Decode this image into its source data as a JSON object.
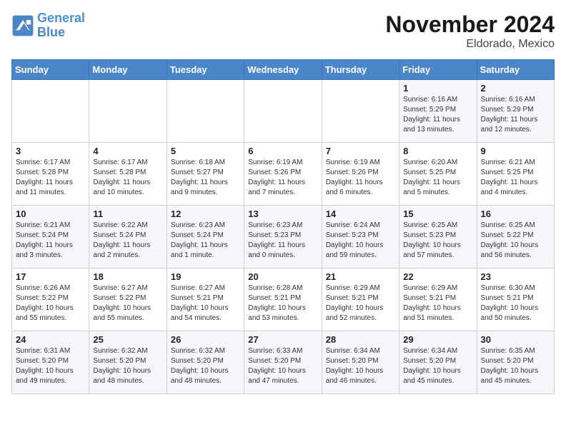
{
  "logo": {
    "line1": "General",
    "line2": "Blue"
  },
  "title": "November 2024",
  "location": "Eldorado, Mexico",
  "weekdays": [
    "Sunday",
    "Monday",
    "Tuesday",
    "Wednesday",
    "Thursday",
    "Friday",
    "Saturday"
  ],
  "weeks": [
    [
      {
        "day": "",
        "info": ""
      },
      {
        "day": "",
        "info": ""
      },
      {
        "day": "",
        "info": ""
      },
      {
        "day": "",
        "info": ""
      },
      {
        "day": "",
        "info": ""
      },
      {
        "day": "1",
        "info": "Sunrise: 6:16 AM\nSunset: 5:29 PM\nDaylight: 11 hours and 13 minutes."
      },
      {
        "day": "2",
        "info": "Sunrise: 6:16 AM\nSunset: 5:29 PM\nDaylight: 11 hours and 12 minutes."
      }
    ],
    [
      {
        "day": "3",
        "info": "Sunrise: 6:17 AM\nSunset: 5:28 PM\nDaylight: 11 hours and 11 minutes."
      },
      {
        "day": "4",
        "info": "Sunrise: 6:17 AM\nSunset: 5:28 PM\nDaylight: 11 hours and 10 minutes."
      },
      {
        "day": "5",
        "info": "Sunrise: 6:18 AM\nSunset: 5:27 PM\nDaylight: 11 hours and 9 minutes."
      },
      {
        "day": "6",
        "info": "Sunrise: 6:19 AM\nSunset: 5:26 PM\nDaylight: 11 hours and 7 minutes."
      },
      {
        "day": "7",
        "info": "Sunrise: 6:19 AM\nSunset: 5:26 PM\nDaylight: 11 hours and 6 minutes."
      },
      {
        "day": "8",
        "info": "Sunrise: 6:20 AM\nSunset: 5:25 PM\nDaylight: 11 hours and 5 minutes."
      },
      {
        "day": "9",
        "info": "Sunrise: 6:21 AM\nSunset: 5:25 PM\nDaylight: 11 hours and 4 minutes."
      }
    ],
    [
      {
        "day": "10",
        "info": "Sunrise: 6:21 AM\nSunset: 5:24 PM\nDaylight: 11 hours and 3 minutes."
      },
      {
        "day": "11",
        "info": "Sunrise: 6:22 AM\nSunset: 5:24 PM\nDaylight: 11 hours and 2 minutes."
      },
      {
        "day": "12",
        "info": "Sunrise: 6:23 AM\nSunset: 5:24 PM\nDaylight: 11 hours and 1 minute."
      },
      {
        "day": "13",
        "info": "Sunrise: 6:23 AM\nSunset: 5:23 PM\nDaylight: 11 hours and 0 minutes."
      },
      {
        "day": "14",
        "info": "Sunrise: 6:24 AM\nSunset: 5:23 PM\nDaylight: 10 hours and 59 minutes."
      },
      {
        "day": "15",
        "info": "Sunrise: 6:25 AM\nSunset: 5:23 PM\nDaylight: 10 hours and 57 minutes."
      },
      {
        "day": "16",
        "info": "Sunrise: 6:25 AM\nSunset: 5:22 PM\nDaylight: 10 hours and 56 minutes."
      }
    ],
    [
      {
        "day": "17",
        "info": "Sunrise: 6:26 AM\nSunset: 5:22 PM\nDaylight: 10 hours and 55 minutes."
      },
      {
        "day": "18",
        "info": "Sunrise: 6:27 AM\nSunset: 5:22 PM\nDaylight: 10 hours and 55 minutes."
      },
      {
        "day": "19",
        "info": "Sunrise: 6:27 AM\nSunset: 5:21 PM\nDaylight: 10 hours and 54 minutes."
      },
      {
        "day": "20",
        "info": "Sunrise: 6:28 AM\nSunset: 5:21 PM\nDaylight: 10 hours and 53 minutes."
      },
      {
        "day": "21",
        "info": "Sunrise: 6:29 AM\nSunset: 5:21 PM\nDaylight: 10 hours and 52 minutes."
      },
      {
        "day": "22",
        "info": "Sunrise: 6:29 AM\nSunset: 5:21 PM\nDaylight: 10 hours and 51 minutes."
      },
      {
        "day": "23",
        "info": "Sunrise: 6:30 AM\nSunset: 5:21 PM\nDaylight: 10 hours and 50 minutes."
      }
    ],
    [
      {
        "day": "24",
        "info": "Sunrise: 6:31 AM\nSunset: 5:20 PM\nDaylight: 10 hours and 49 minutes."
      },
      {
        "day": "25",
        "info": "Sunrise: 6:32 AM\nSunset: 5:20 PM\nDaylight: 10 hours and 48 minutes."
      },
      {
        "day": "26",
        "info": "Sunrise: 6:32 AM\nSunset: 5:20 PM\nDaylight: 10 hours and 48 minutes."
      },
      {
        "day": "27",
        "info": "Sunrise: 6:33 AM\nSunset: 5:20 PM\nDaylight: 10 hours and 47 minutes."
      },
      {
        "day": "28",
        "info": "Sunrise: 6:34 AM\nSunset: 5:20 PM\nDaylight: 10 hours and 46 minutes."
      },
      {
        "day": "29",
        "info": "Sunrise: 6:34 AM\nSunset: 5:20 PM\nDaylight: 10 hours and 45 minutes."
      },
      {
        "day": "30",
        "info": "Sunrise: 6:35 AM\nSunset: 5:20 PM\nDaylight: 10 hours and 45 minutes."
      }
    ]
  ]
}
